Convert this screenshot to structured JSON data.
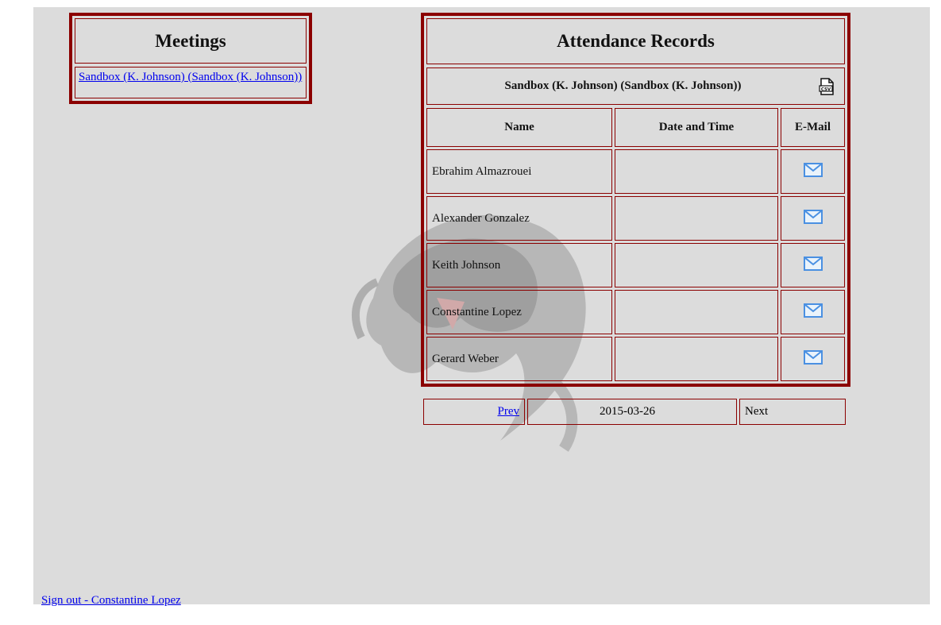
{
  "meetings": {
    "title": "Meetings",
    "items": [
      {
        "label": "Sandbox (K. Johnson) (Sandbox (K. Johnson))"
      }
    ]
  },
  "attendance": {
    "title": "Attendance Records",
    "meeting_name": "Sandbox (K. Johnson) (Sandbox (K. Johnson))",
    "export_icon": "csv-file-icon",
    "columns": [
      "Name",
      "Date and Time",
      "E-Mail"
    ],
    "rows": [
      {
        "name": "Ebrahim Almazrouei",
        "datetime": "",
        "email_icon": "envelope-icon"
      },
      {
        "name": "Alexander Gonzalez",
        "datetime": "",
        "email_icon": "envelope-icon"
      },
      {
        "name": "Keith Johnson",
        "datetime": "",
        "email_icon": "envelope-icon"
      },
      {
        "name": "Constantine Lopez",
        "datetime": "",
        "email_icon": "envelope-icon"
      },
      {
        "name": "Gerard Weber",
        "datetime": "",
        "email_icon": "envelope-icon"
      }
    ]
  },
  "pager": {
    "prev_label": "Prev",
    "date": "2015-03-26",
    "next_label": "Next"
  },
  "footer": {
    "signout_label": "Sign out - Constantine Lopez"
  },
  "colors": {
    "border": "#8b0000",
    "background": "#dcdcdc",
    "link": "#0000ee",
    "mail_icon": "#4a90e2"
  }
}
